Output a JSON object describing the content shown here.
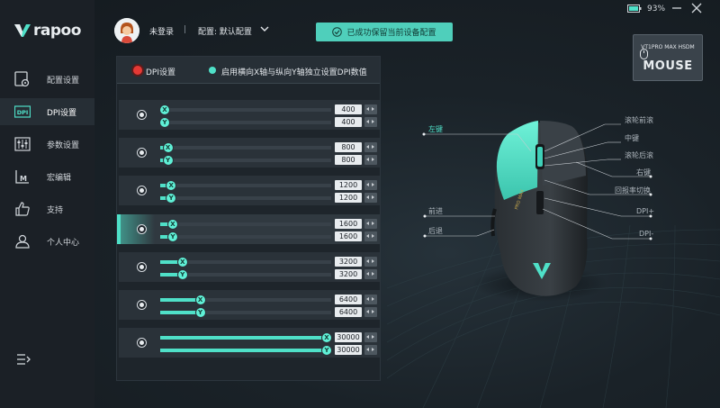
{
  "app": {
    "brand": "rapoo"
  },
  "window": {
    "battery": "93%"
  },
  "sidebar": {
    "items": [
      {
        "label": "配置设置",
        "icon": "config-icon"
      },
      {
        "label": "DPI设置",
        "icon": "dpi-icon"
      },
      {
        "label": "参数设置",
        "icon": "params-icon"
      },
      {
        "label": "宏编辑",
        "icon": "macro-icon"
      },
      {
        "label": "支持",
        "icon": "thumbs-up-icon"
      },
      {
        "label": "个人中心",
        "icon": "user-icon"
      }
    ],
    "active_index": 1
  },
  "header": {
    "login": "未登录",
    "separator": "|",
    "config": "配置: 默认配置",
    "save_status": "已成功保留当前设备配置"
  },
  "device": {
    "model": "VT1PRO MAX HSDM",
    "label": "MOUSE",
    "mouse_logo": "PRO MAX"
  },
  "dpi": {
    "title": "DPI设置",
    "independent_label": "启用横向X轴与纵向Y轴独立设置DPI数值",
    "active_row": 3,
    "rows": [
      {
        "x": "400",
        "y": "400",
        "level": 0.0
      },
      {
        "x": "800",
        "y": "800",
        "level": 0.02
      },
      {
        "x": "1200",
        "y": "1200",
        "level": 0.04
      },
      {
        "x": "1600",
        "y": "1600",
        "level": 0.05
      },
      {
        "x": "3200",
        "y": "3200",
        "level": 0.11
      },
      {
        "x": "6400",
        "y": "6400",
        "level": 0.22
      },
      {
        "x": "30000",
        "y": "30000",
        "level": 1.0
      }
    ],
    "axis_x": "X",
    "axis_y": "Y"
  },
  "callouts": {
    "left": "左键",
    "wheel_fwd": "滚轮前滚",
    "middle": "中键",
    "wheel_back": "滚轮后滚",
    "right": "右键",
    "report_rate": "回报率切换",
    "dpi_plus": "DPI+",
    "dpi_minus": "DPI-",
    "forward": "前进",
    "back": "后退"
  },
  "colors": {
    "accent": "#4fe0c8",
    "save_bg": "#4fcfbb",
    "active_radio": "#e53935",
    "sidebar_bg": "#1b2026"
  }
}
